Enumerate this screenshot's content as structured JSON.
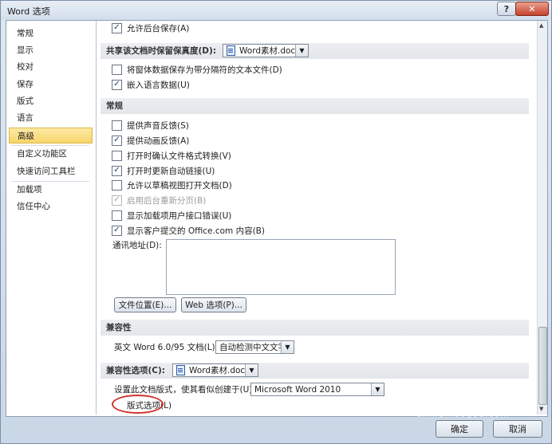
{
  "window": {
    "title": "Word 选项",
    "help_label": "?",
    "close_label": "✕"
  },
  "nav": {
    "items": [
      "常规",
      "显示",
      "校对",
      "保存",
      "版式",
      "语言",
      "高级",
      "自定义功能区",
      "快速访问工具栏",
      "加载项",
      "信任中心"
    ],
    "active_index": 6
  },
  "content": {
    "top_option": {
      "label": "允许后台保存(A)",
      "checked": true
    },
    "share_header": "共享该文档时保留保真度(D):",
    "share_doc": "Word素材.docx",
    "share_options": [
      {
        "label": "将窗体数据保存为带分隔符的文本文件(D)",
        "checked": false
      },
      {
        "label": "嵌入语言数据(U)",
        "checked": true
      }
    ],
    "general_header": "常规",
    "general_options": [
      {
        "label": "提供声音反馈(S)",
        "checked": false
      },
      {
        "label": "提供动画反馈(A)",
        "checked": true
      },
      {
        "label": "打开时确认文件格式转换(V)",
        "checked": false
      },
      {
        "label": "打开时更新自动链接(U)",
        "checked": true
      },
      {
        "label": "允许以草稿视图打开文档(D)",
        "checked": false
      },
      {
        "label": "启用后台重新分页(B)",
        "checked": true,
        "disabled": true
      },
      {
        "label": "显示加载项用户接口错误(U)",
        "checked": false
      },
      {
        "label": "显示客户提交的 Office.com 内容(B)",
        "checked": true
      }
    ],
    "mail_address_label": "通讯地址(D):",
    "file_location_button": "文件位置(E)...",
    "web_options_button": "Web 选项(P)...",
    "compat_header": "兼容性",
    "compat_word6_label": "英文 Word 6.0/95 文档(L):",
    "compat_word6_value": "自动检测中文文字",
    "compat_options_header": "兼容性选项(C):",
    "compat_doc": "Word素材.docx",
    "layout_as_label": "设置此文档版式，使其看似创建于(U):",
    "layout_as_value": "Microsoft Word 2010",
    "layout_options_link": "版式选项(L)"
  },
  "buttons": {
    "ok": "确定",
    "cancel": "取消"
  },
  "watermark": {
    "logo": "S",
    "text": "搜狗指南",
    "sub": "zhinan.sogou.com"
  },
  "colors": {
    "active_nav": "#f8d56a",
    "annotation": "#d2322d",
    "title_close": "#c7432c"
  }
}
